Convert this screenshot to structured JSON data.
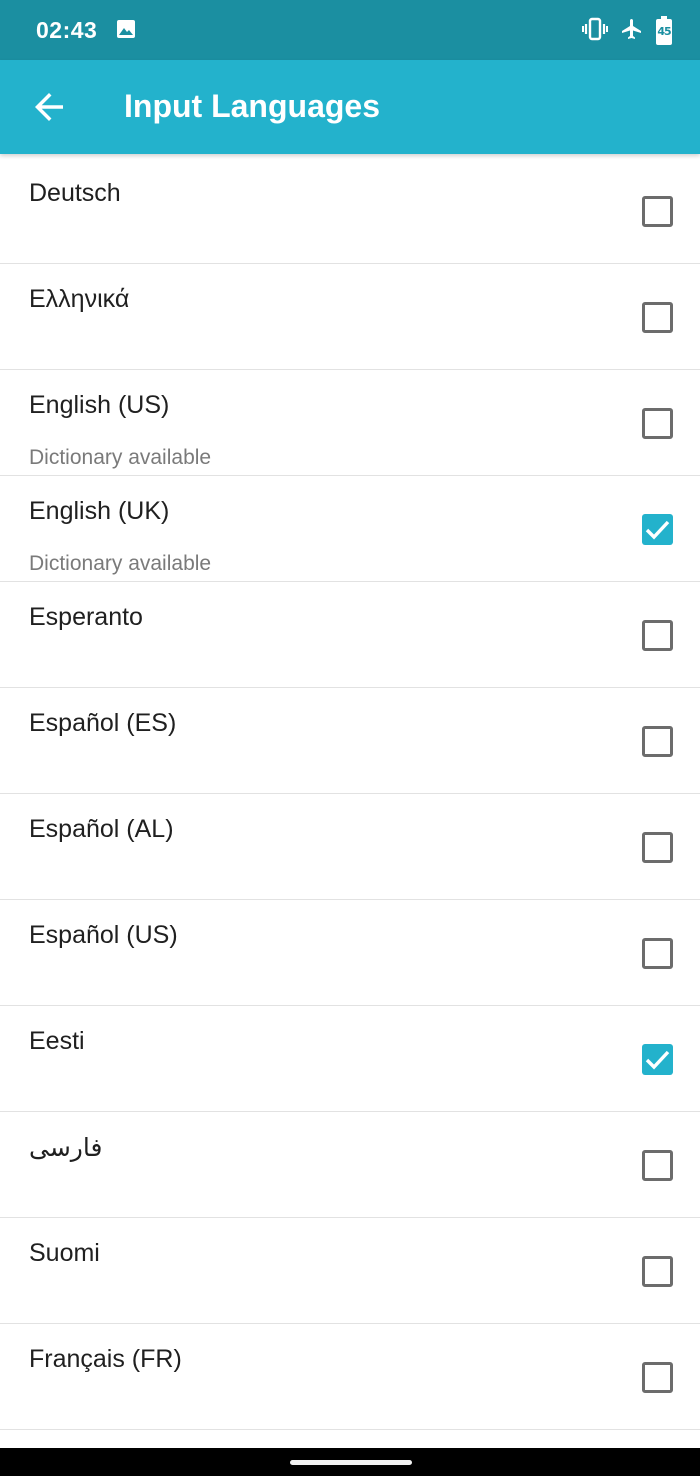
{
  "status_bar": {
    "time": "02:43",
    "battery_level": "45",
    "icons": [
      "image-icon",
      "vibrate-icon",
      "airplane-mode-icon",
      "battery-icon"
    ]
  },
  "app_bar": {
    "title": "Input Languages",
    "back_icon": "arrow-left-icon"
  },
  "colors": {
    "status_bar": "#1b8fa1",
    "app_bar": "#23b2cc",
    "accent": "#23b2cc",
    "checkbox_border": "#6c6c6c"
  },
  "languages": [
    {
      "label": "Deutsch",
      "subtitle": "",
      "checked": false
    },
    {
      "label": "Ελληνικά",
      "subtitle": "",
      "checked": false
    },
    {
      "label": "English (US)",
      "subtitle": "Dictionary available",
      "checked": false
    },
    {
      "label": "English (UK)",
      "subtitle": "Dictionary available",
      "checked": true
    },
    {
      "label": "Esperanto",
      "subtitle": "",
      "checked": false
    },
    {
      "label": "Español (ES)",
      "subtitle": "",
      "checked": false
    },
    {
      "label": "Español (AL)",
      "subtitle": "",
      "checked": false
    },
    {
      "label": "Español (US)",
      "subtitle": "",
      "checked": false
    },
    {
      "label": "Eesti",
      "subtitle": "",
      "checked": true
    },
    {
      "label": "فارسی",
      "subtitle": "",
      "checked": false
    },
    {
      "label": "Suomi",
      "subtitle": "",
      "checked": false
    },
    {
      "label": "Français (FR)",
      "subtitle": "",
      "checked": false
    }
  ]
}
